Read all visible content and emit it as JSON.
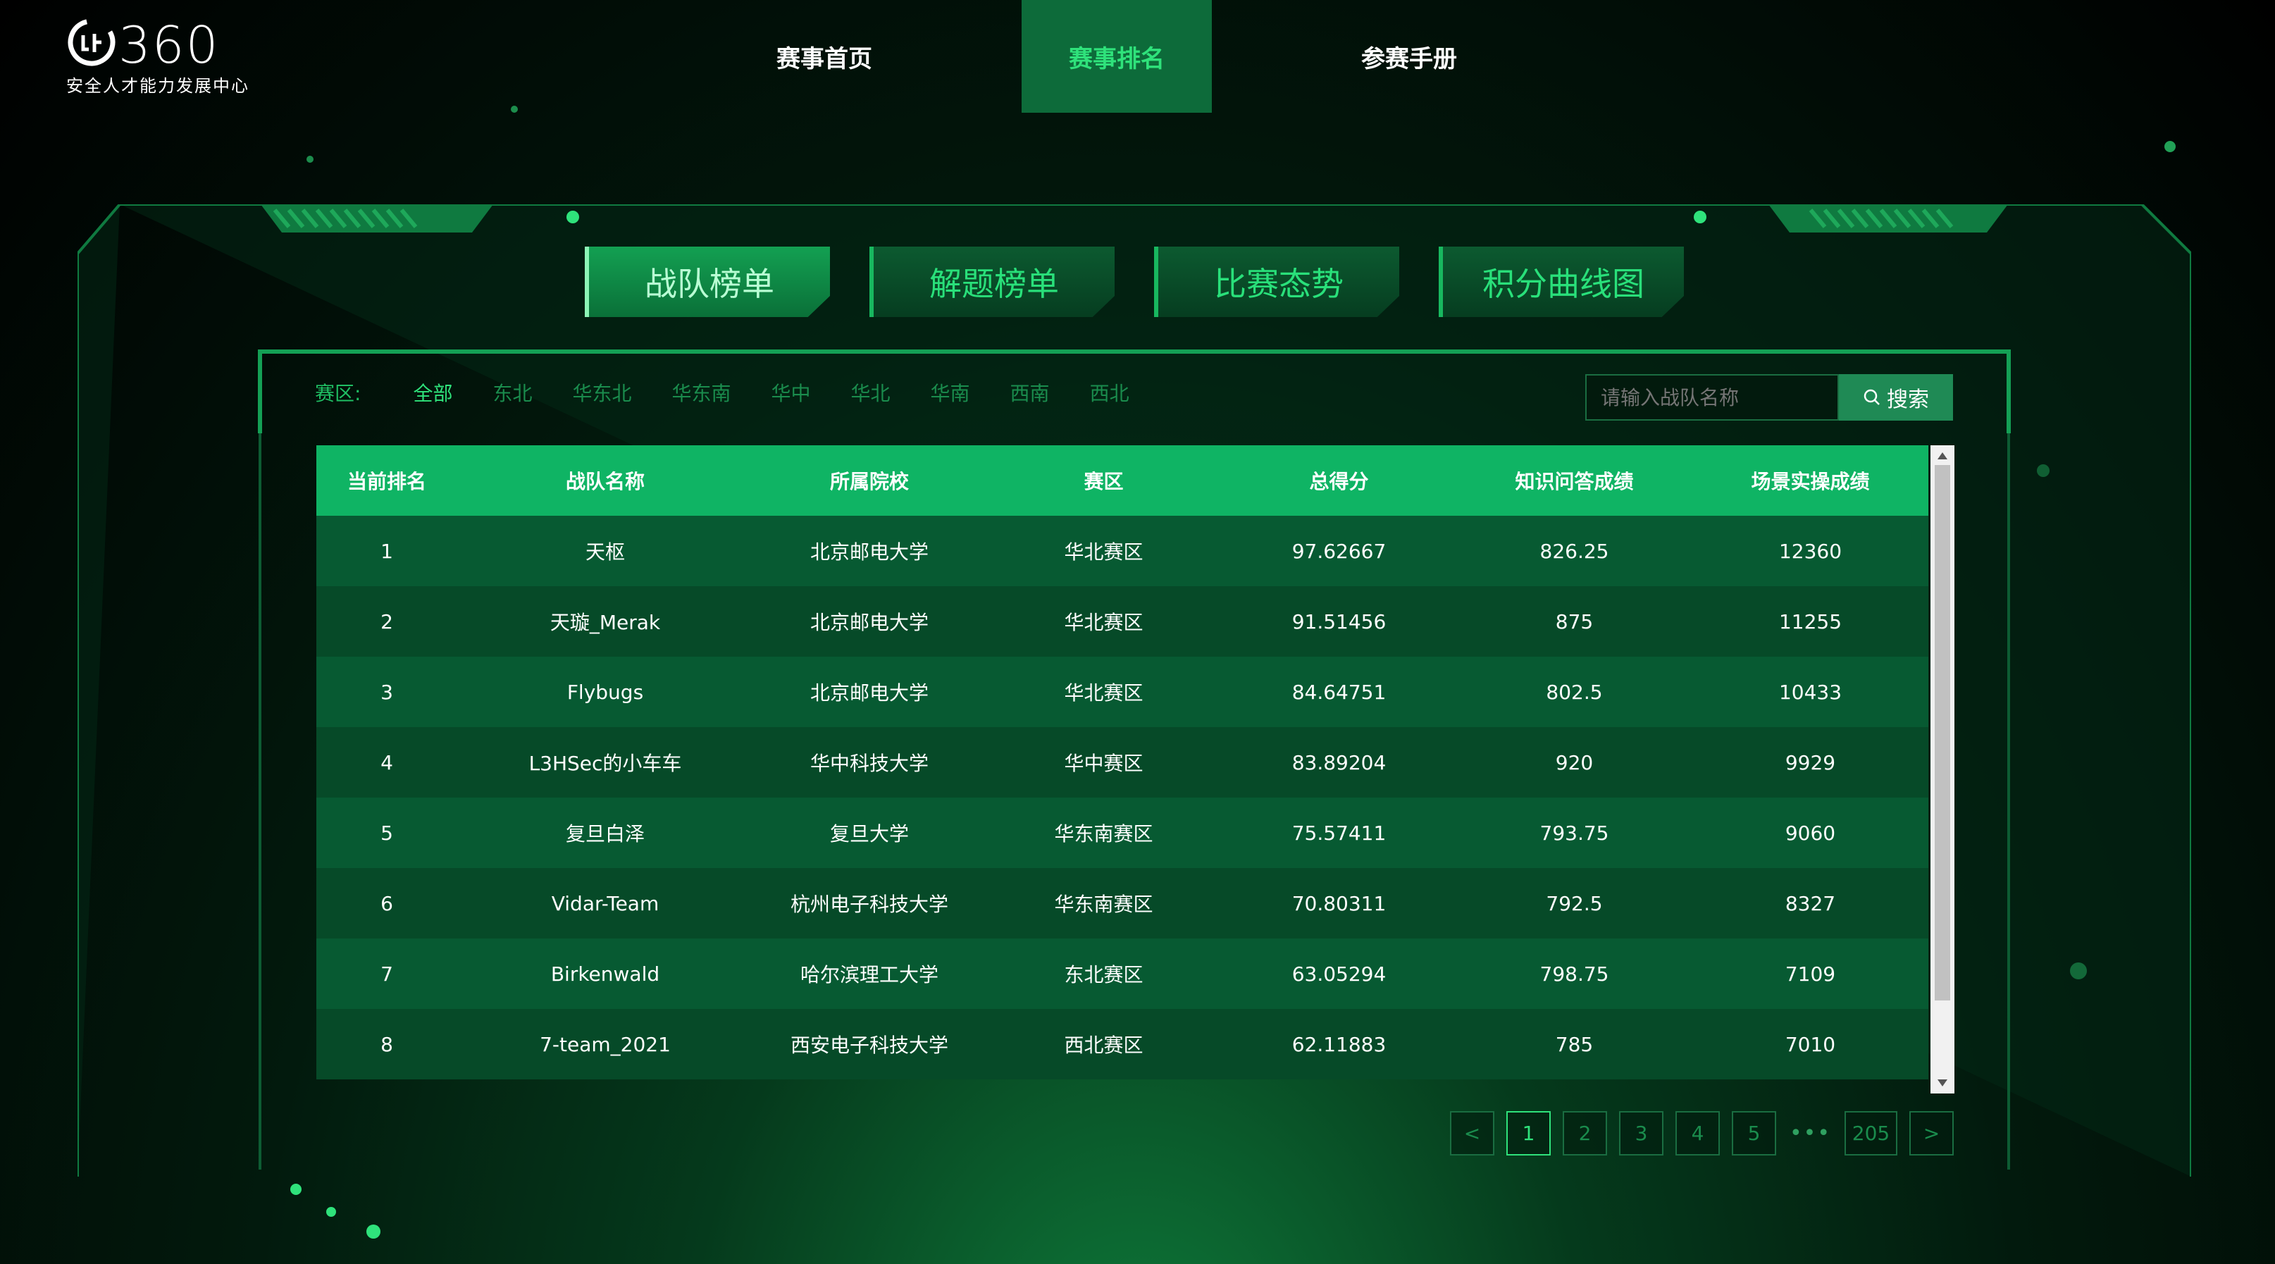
{
  "header": {
    "logo_text": "360",
    "logo_subtitle": "安全人才能力发展中心",
    "nav": [
      {
        "label": "赛事首页",
        "active": false
      },
      {
        "label": "赛事排名",
        "active": true
      },
      {
        "label": "参赛手册",
        "active": false
      }
    ]
  },
  "tabs": [
    {
      "label": "战队榜单",
      "active": true
    },
    {
      "label": "解题榜单",
      "active": false
    },
    {
      "label": "比赛态势",
      "active": false
    },
    {
      "label": "积分曲线图",
      "active": false
    }
  ],
  "filters": {
    "label": "赛区:",
    "regions": [
      "全部",
      "东北",
      "华东北",
      "华东南",
      "华中",
      "华北",
      "华南",
      "西南",
      "西北"
    ],
    "active": "全部"
  },
  "search": {
    "placeholder": "请输入战队名称",
    "button_label": "搜索"
  },
  "table": {
    "columns": [
      "当前排名",
      "战队名称",
      "所属院校",
      "赛区",
      "总得分",
      "知识问答成绩",
      "场景实操成绩"
    ],
    "rows": [
      [
        "1",
        "天枢",
        "北京邮电大学",
        "华北赛区",
        "97.62667",
        "826.25",
        "12360"
      ],
      [
        "2",
        "天璇_Merak",
        "北京邮电大学",
        "华北赛区",
        "91.51456",
        "875",
        "11255"
      ],
      [
        "3",
        "Flybugs",
        "北京邮电大学",
        "华北赛区",
        "84.64751",
        "802.5",
        "10433"
      ],
      [
        "4",
        "L3HSec的小车车",
        "华中科技大学",
        "华中赛区",
        "83.89204",
        "920",
        "9929"
      ],
      [
        "5",
        "复旦白泽",
        "复旦大学",
        "华东南赛区",
        "75.57411",
        "793.75",
        "9060"
      ],
      [
        "6",
        "Vidar-Team",
        "杭州电子科技大学",
        "华东南赛区",
        "70.80311",
        "792.5",
        "8327"
      ],
      [
        "7",
        "Birkenwald",
        "哈尔滨理工大学",
        "东北赛区",
        "63.05294",
        "798.75",
        "7109"
      ],
      [
        "8",
        "7-team_2021",
        "西安电子科技大学",
        "西北赛区",
        "62.11883",
        "785",
        "7010"
      ]
    ]
  },
  "pagination": {
    "prev": "<",
    "pages": [
      "1",
      "2",
      "3",
      "4",
      "5"
    ],
    "ellipsis": "•••",
    "last": "205",
    "next": ">",
    "current": "1"
  },
  "colors": {
    "accent": "#2fe27b",
    "table_header": "#0fb464",
    "row_odd": "#075a32",
    "row_even": "#064a28"
  }
}
